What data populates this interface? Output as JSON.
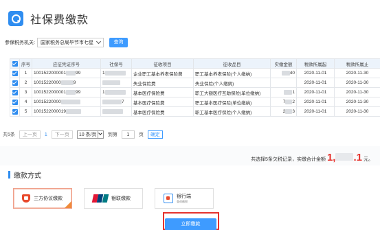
{
  "header": {
    "title": "社保费缴款"
  },
  "filter": {
    "label": "参保税务机关:",
    "value": "国家税务总局毕节市七星",
    "query_label": "查询"
  },
  "table": {
    "columns": [
      "序号",
      "应征凭证序号",
      "社保号",
      "征收项目",
      "征收品目",
      "实缴金额",
      "税款所属起",
      "税款所属止"
    ],
    "rows": [
      {
        "seq": "1",
        "voucher_prefix": "1001522000001",
        "voucher_suffix": "99",
        "si_prefix": "1",
        "si_suffix": "",
        "item": "企业职工基本养老保险费",
        "subitem": "职工基本养老保险(个人缴纳)",
        "amount_suffix": "40",
        "start": "2020-11-01",
        "end": "2020-11-30"
      },
      {
        "seq": "2",
        "voucher_prefix": "10015220000",
        "voucher_suffix": "9",
        "si_prefix": "",
        "si_suffix": "",
        "item": "失业保险费",
        "subitem": "失业保险(个人缴纳)",
        "amount_suffix": "",
        "start": "2020-11-01",
        "end": "2020-11-30"
      },
      {
        "seq": "3",
        "voucher_prefix": "1001522000001",
        "voucher_suffix": "99",
        "si_prefix": "1",
        "si_suffix": "",
        "item": "基本医疗保险费",
        "subitem": "职工大额医疗互助保险(单位缴纳)",
        "amount_suffix": "1",
        "start": "2020-11-01",
        "end": "2020-11-30"
      },
      {
        "seq": "4",
        "voucher_prefix": "10015220000",
        "voucher_suffix": "",
        "si_prefix": "",
        "si_suffix": "7",
        "item": "基本医疗保险费",
        "subitem": "职工基本医疗保险(单位缴纳)",
        "amount_suffix": "2",
        "amount_prefix": "7",
        "start": "2020-11-01",
        "end": "2020-11-30"
      },
      {
        "seq": "5",
        "voucher_prefix": "1001522000019",
        "voucher_suffix": "",
        "si_prefix": "",
        "si_suffix": "",
        "item": "基本医疗保险费",
        "subitem": "职工基本医疗保险(个人缴纳)",
        "amount_suffix": "3",
        "amount_prefix": "2",
        "start": "2020-11-01",
        "end": "2020-11-30"
      }
    ]
  },
  "pager": {
    "total": "共5条",
    "prev": "上一页",
    "page": "1",
    "next": "下一页",
    "page_size": "10 条/页",
    "goto_label": "到第",
    "goto_value": "1",
    "page_unit": "页",
    "confirm": "确定"
  },
  "summary": {
    "text": "共选择5条欠税记录，实缴合计金额",
    "amount_head": "1,",
    "amount_tail": ".1",
    "unit": "元。"
  },
  "methods_section": {
    "title": "缴款方式"
  },
  "methods": [
    {
      "label": "三方协议缴款",
      "icon": "shield-icon"
    },
    {
      "label": "银联缴款",
      "icon": "unionpay-icon"
    },
    {
      "label": "银行端",
      "sub": "查询缴税",
      "icon": "bank-icon"
    }
  ],
  "pay_button": {
    "label": "立即缴款"
  },
  "colors": {
    "accent": "#2f8df0",
    "danger": "#e5322d",
    "button": "#3e9bff"
  }
}
